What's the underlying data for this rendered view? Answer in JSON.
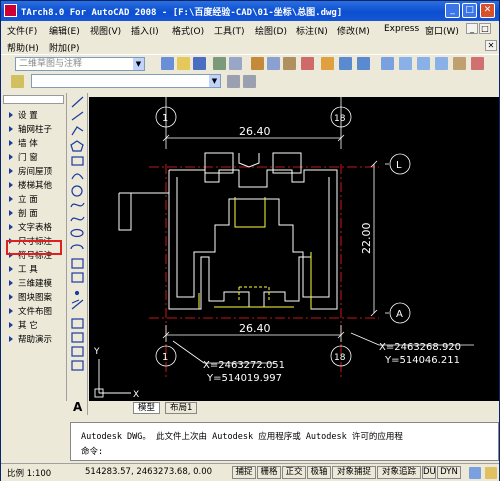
{
  "window": {
    "title": "TArch8.0 For AutoCAD 2008 - [F:\\百度经验-CAD\\01-坐标\\总图.dwg]"
  },
  "menus_row1": [
    "文件(F)",
    "编辑(E)",
    "视图(V)",
    "插入(I)",
    "格式(O)",
    "工具(T)",
    "绘图(D)",
    "标注(N)",
    "修改(M)",
    "Express",
    "窗口(W)"
  ],
  "menus_row2": [
    "帮助(H)",
    "附加(P)"
  ],
  "toolbar": {
    "workspace": "二维草图与注释"
  },
  "palette_items": [
    "设  置",
    "轴网柱子",
    "墙  体",
    "门  窗",
    "房间屋顶",
    "楼梯其他",
    "立  面",
    "剖  面",
    "文字表格",
    "尺寸标注",
    "符号标注",
    "工  具",
    "三维建模",
    "图块图案",
    "文件布图",
    "其  它",
    "帮助演示"
  ],
  "drawing": {
    "dim_top": "26.40",
    "dim_bottom": "26.40",
    "dim_right": "22.00",
    "axis_bubbles": [
      "1",
      "18",
      "L",
      "1",
      "18",
      "A"
    ],
    "coord_left_x": "X=2463272.051",
    "coord_left_y": "Y=514019.997",
    "coord_right_x": "X=2463268.920",
    "coord_right_y": "Y=514046.211",
    "ucs_x": "X",
    "ucs_y": "Y"
  },
  "tabs": [
    "模型",
    "布局1"
  ],
  "command": {
    "line1": "Autodesk DWG。  此文件上次由 Autodesk 应用程序或 Autodesk 许可的应用程",
    "prompt": "命令:"
  },
  "status": {
    "scale": "比例 1:100",
    "coords": "514283.57, 2463273.68, 0.00",
    "toggles": [
      "捕捉",
      "栅格",
      "正交",
      "极轴",
      "对象捕捉",
      "对象追踪",
      "DU",
      "DYN"
    ]
  }
}
